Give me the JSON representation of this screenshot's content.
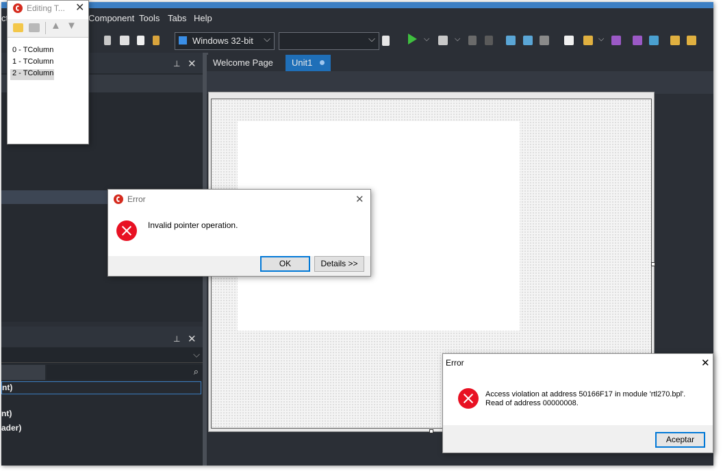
{
  "ide": {
    "menu": {
      "item0": "ct",
      "item1": "Component",
      "item2": "Tools",
      "item3": "Tabs",
      "item4": "Help"
    },
    "platform": "Windows 32-bit",
    "config": "",
    "tabs": [
      {
        "label": "Welcome Page"
      },
      {
        "label": "Unit1"
      }
    ],
    "props": [
      "nt)",
      "nt)",
      "ader)"
    ],
    "colors": {
      "accent": "#3c7fc4",
      "bg": "#2b2f36",
      "tab_active": "#1f6fb8"
    }
  },
  "editor": {
    "title": "Editing T...",
    "items": [
      "0 - TColumn",
      "1 - TColumn",
      "2 - TColumn"
    ]
  },
  "error1": {
    "title": "Error",
    "message": "Invalid pointer operation.",
    "ok": "OK",
    "details": "Details >>"
  },
  "error2": {
    "title": "Error",
    "line1": "Access violation at address 50166F17 in module 'rtl270.bpl'.",
    "line2": "Read of address 00000008.",
    "button": "Aceptar"
  }
}
